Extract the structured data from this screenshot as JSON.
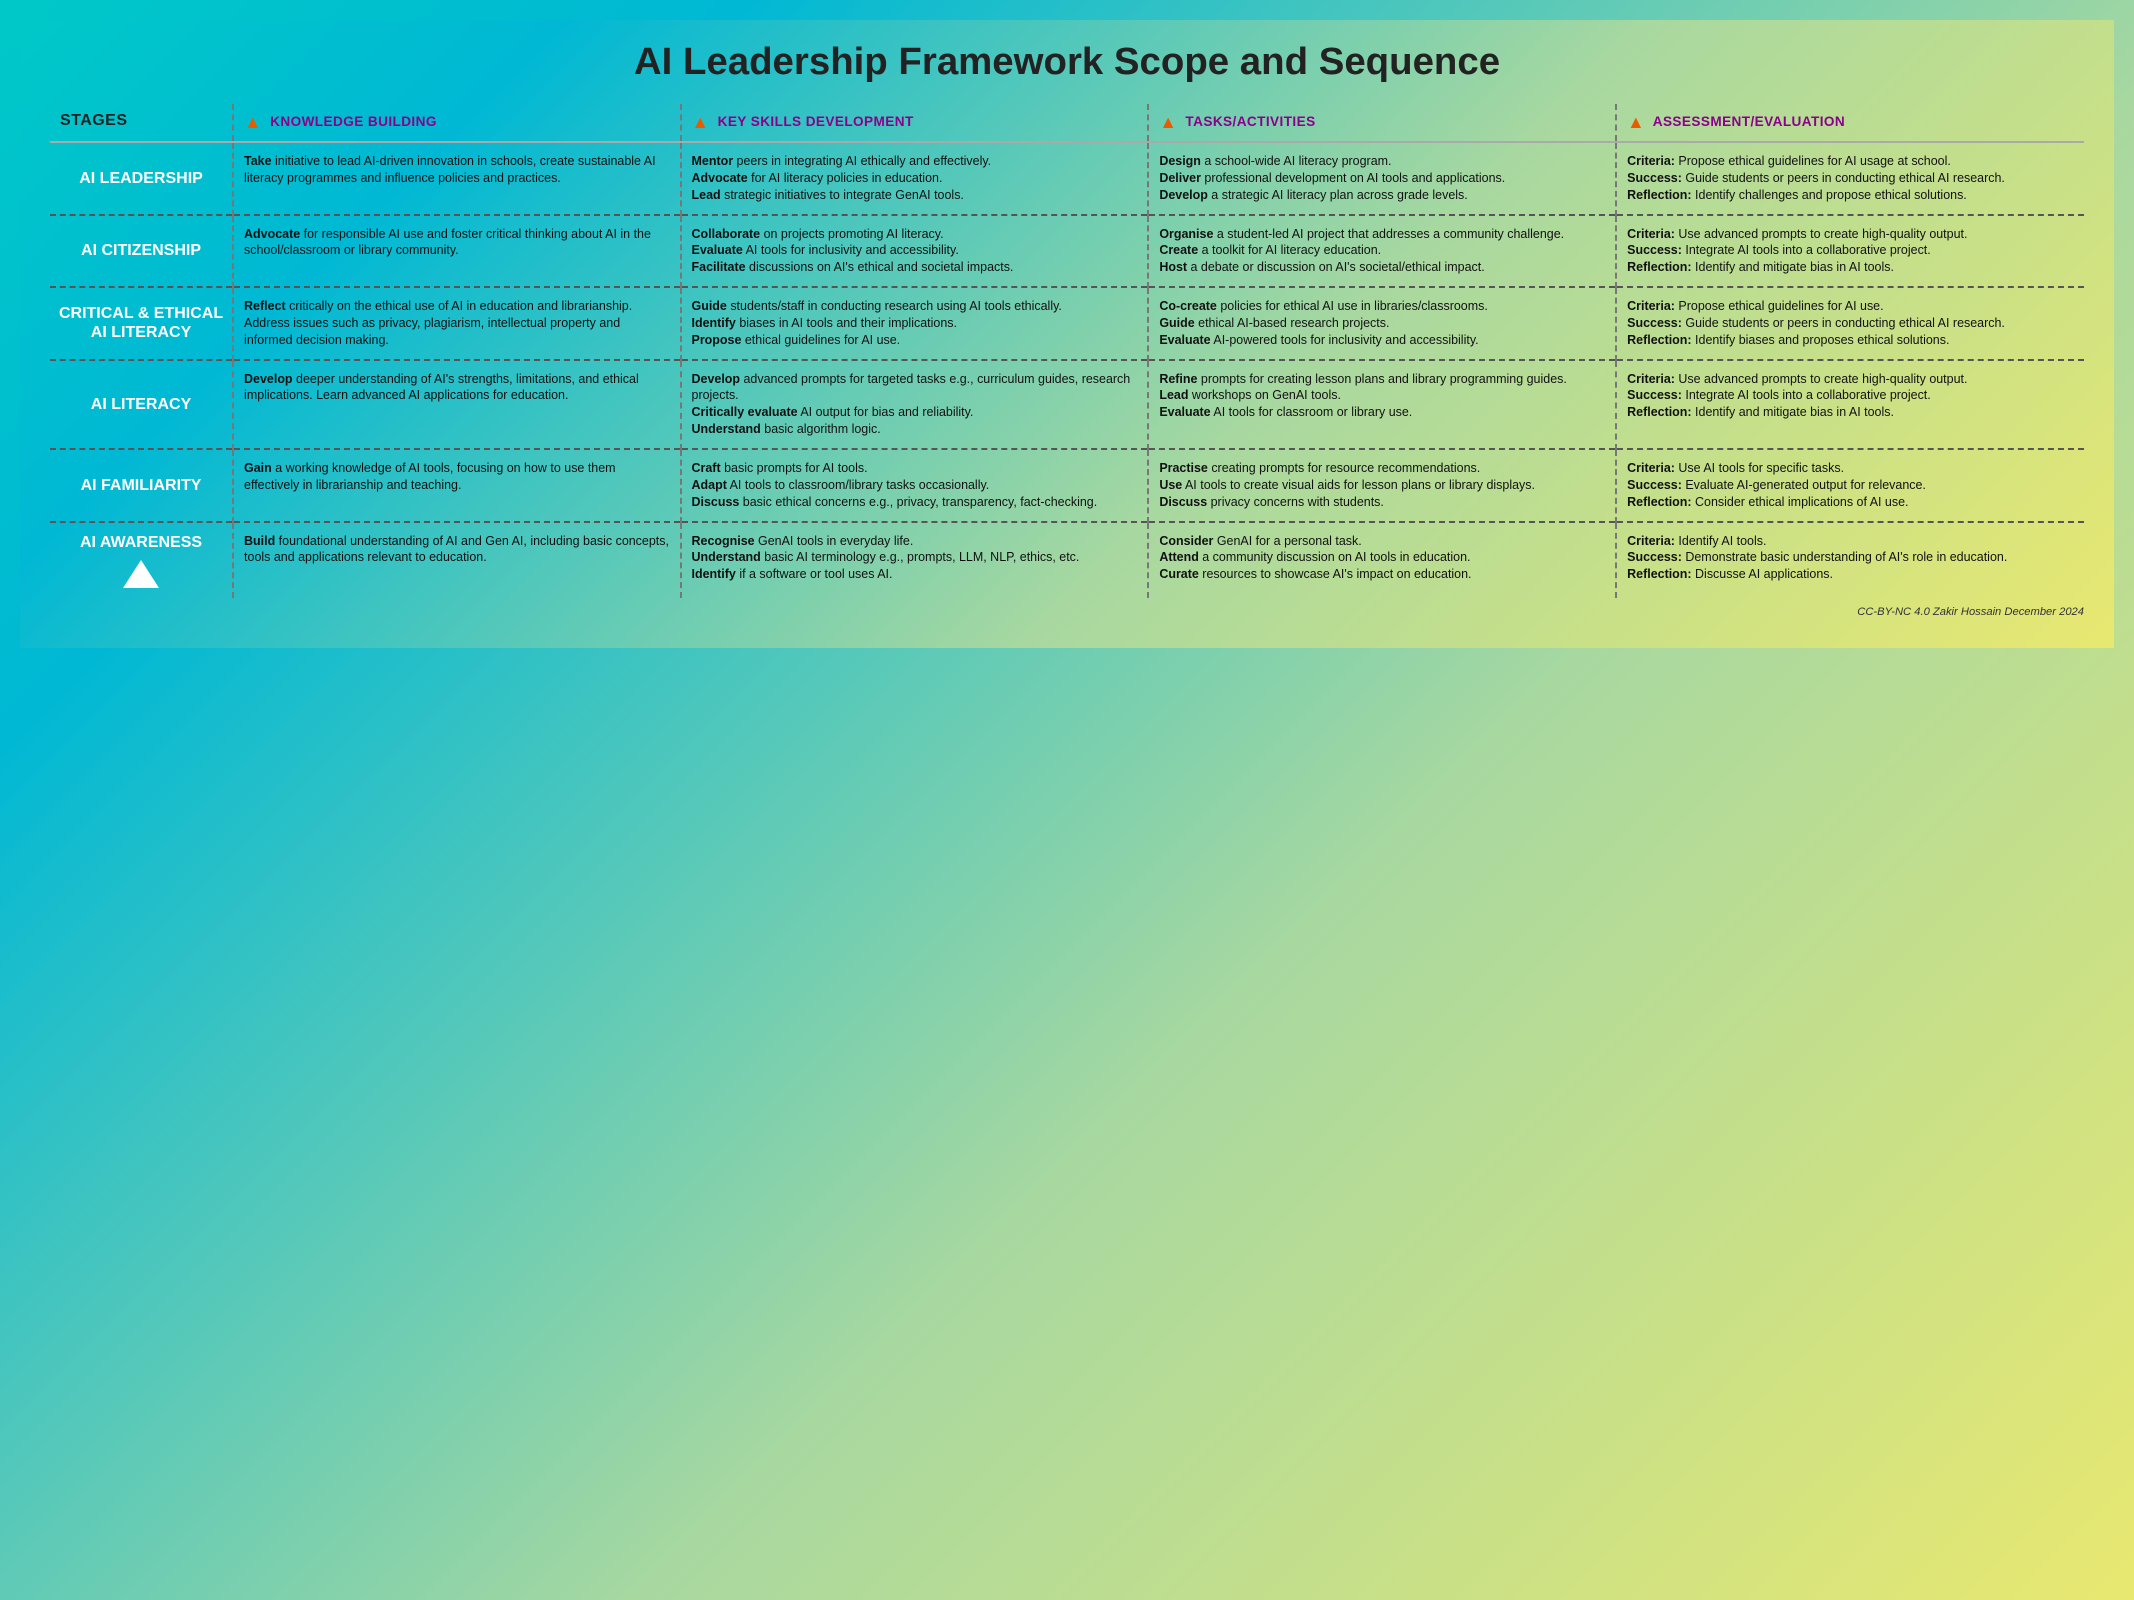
{
  "title": "AI Leadership Framework Scope and Sequence",
  "header": {
    "stages": "STAGES",
    "kb": "KNOWLEDGE BUILDING",
    "ks": "KEY SKILLS DEVELOPMENT",
    "ta": "TASKS/ACTIVITIES",
    "ae": "ASSESSMENT/EVALUATION"
  },
  "footer": "CC-BY-NC 4.0 Zakir Hossain December 2024",
  "rows": [
    {
      "stage": "AI LEADERSHIP",
      "kb": "<b>Take</b> initiative to lead AI-driven innovation in schools, create sustainable AI literacy programmes and influence policies and practices.",
      "ks": "<b>Mentor</b> peers in integrating AI ethically and effectively.<br><b>Advocate</b> for AI literacy policies in education.<br><b>Lead</b> strategic initiatives to integrate GenAI tools.",
      "ta": "<b>Design</b> a school-wide AI literacy program.<br><b>Deliver</b> professional development on AI tools and applications.<br><b>Develop</b> a strategic AI literacy plan across grade levels.",
      "ae": "<b>Criteria:</b> Propose ethical guidelines for AI usage at school.<br><b>Success:</b> Guide students or peers in conducting ethical AI research.<br><b>Reflection:</b> Identify challenges and propose ethical solutions."
    },
    {
      "stage": "AI CITIZENSHIP",
      "kb": "<b>Advocate</b> for responsible AI use and foster critical thinking about AI in the school/classroom or library community.",
      "ks": "<b>Collaborate</b> on projects promoting AI literacy.<br><b>Evaluate</b> AI tools for inclusivity and accessibility.<br><b>Facilitate</b> discussions on AI's ethical and societal impacts.",
      "ta": "<b>Organise</b> a student-led AI project that addresses a community challenge.<br><b>Create</b> a toolkit for AI literacy education.<br><b>Host</b> a debate or discussion on AI's societal/ethical impact.",
      "ae": "<b>Criteria:</b> Use advanced prompts to create high-quality output.<br><b>Success:</b> Integrate AI tools into a collaborative project.<br><b>Reflection:</b> Identify and mitigate bias in AI tools."
    },
    {
      "stage": "CRITICAL & ETHICAL AI LITERACY",
      "kb": "<b>Reflect</b> critically on the ethical use of AI in education and librarianship. Address issues such as privacy, plagiarism, intellectual property and informed decision making.",
      "ks": "<b>Guide</b> students/staff in conducting research using AI tools ethically.<br><b>Identify</b> biases in AI tools and their implications.<br><b>Propose</b> ethical guidelines for AI use.",
      "ta": "<b>Co-create</b> policies for ethical AI use in libraries/classrooms.<br><b>Guide</b> ethical AI-based research projects.<br><b>Evaluate</b> AI-powered tools for inclusivity and accessibility.",
      "ae": "<b>Criteria:</b> Propose ethical guidelines for AI use.<br><b>Success:</b> Guide students or peers in conducting ethical AI research.<br><b>Reflection:</b> Identify biases and proposes ethical solutions."
    },
    {
      "stage": "AI LITERACY",
      "kb": "<b>Develop</b> deeper understanding of AI's strengths, limitations, and ethical implications. Learn advanced AI applications for education.",
      "ks": "<b>Develop</b> advanced prompts for targeted tasks e.g., curriculum guides, research projects.<br><b>Critically evaluate</b> AI output for bias and reliability.<br><b>Understand</b> basic algorithm logic.",
      "ta": "<b>Refine</b> prompts for creating lesson plans and library programming guides.<br><b>Lead</b> workshops on GenAI tools.<br><b>Evaluate</b> AI tools for classroom or library use.",
      "ae": "<b>Criteria:</b> Use advanced prompts to create high-quality output.<br><b>Success:</b> Integrate AI tools into a collaborative project.<br><b>Reflection:</b> Identify and mitigate bias in AI tools."
    },
    {
      "stage": "AI FAMILIARITY",
      "kb": "<b>Gain</b> a working knowledge of AI tools, focusing on how to use them effectively in librarianship and teaching.",
      "ks": "<b>Craft</b> basic prompts for AI tools.<br><b>Adapt</b> AI tools to classroom/library tasks occasionally.<br><b>Discuss</b> basic ethical concerns e.g., privacy, transparency, fact-checking.",
      "ta": "<b>Practise</b> creating prompts for resource recommendations.<br><b>Use</b> AI tools to create visual aids for lesson plans or library displays.<br><b>Discuss</b> privacy concerns with students.",
      "ae": "<b>Criteria:</b> Use AI tools for specific tasks.<br><b>Success:</b> Evaluate AI-generated output for relevance.<br><b>Reflection:</b> Consider ethical implications of AI use."
    },
    {
      "stage": "AI AWARENESS",
      "kb": "<b>Build</b> foundational understanding of AI and Gen AI, including basic concepts, tools and applications relevant to education.",
      "ks": "<b>Recognise</b> GenAI tools in everyday life.<br><b>Understand</b> basic AI terminology e.g., prompts, LLM, NLP, ethics, etc.<br><b>Identify</b> if a software or tool uses AI.",
      "ta": "<b>Consider</b> GenAI for a personal task.<br><b>Attend</b> a community discussion on AI tools in education.<br><b>Curate</b> resources to showcase AI's impact on education.",
      "ae": "<b>Criteria:</b> Identify AI tools.<br><b>Success:</b> Demonstrate basic understanding of AI's role in education.<br><b>Reflection:</b> Discusse AI applications.",
      "showArrow": true
    }
  ]
}
